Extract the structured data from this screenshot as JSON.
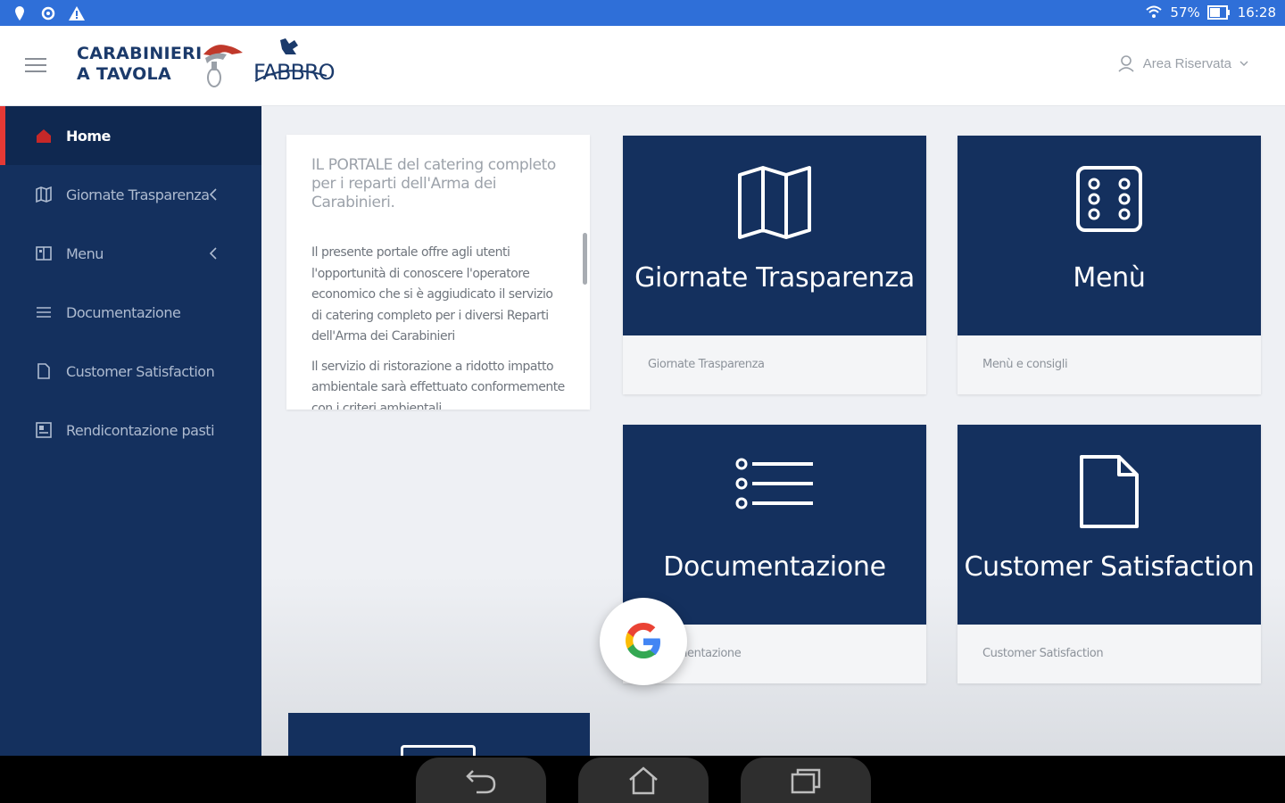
{
  "status_bar": {
    "battery": "57%",
    "time": "16:28",
    "left_icons": [
      "location-pin-icon",
      "sync-icon",
      "warning-icon"
    ],
    "right_icons": [
      "wifi-icon",
      "battery-icon"
    ]
  },
  "header": {
    "brand_line1": "CARABINIERI",
    "brand_line2": "A TAVOLA",
    "partner_logo_text": "FABBRO",
    "area_riservata_label": "Area Riservata"
  },
  "sidebar": {
    "items": [
      {
        "label": "Home",
        "icon": "home-icon",
        "active": true
      },
      {
        "label": "Giornate Trasparenza",
        "icon": "map-icon",
        "chevron": true
      },
      {
        "label": "Menu",
        "icon": "book-icon",
        "chevron": true
      },
      {
        "label": "Documentazione",
        "icon": "list-icon"
      },
      {
        "label": "Customer Satisfaction",
        "icon": "file-icon"
      },
      {
        "label": "Rendicontazione pasti",
        "icon": "report-icon"
      }
    ]
  },
  "intro": {
    "title": "IL PORTALE del catering completo per i reparti dell'Arma dei Carabinieri.",
    "p1": "Il presente portale offre agli utenti l'opportunità di conoscere l'operatore economico che si è aggiudicato il servizio di catering completo per i diversi Reparti dell'Arma dei Carabinieri",
    "p2": "Il servizio di ristorazione a ridotto impatto ambientale sarà effettuato conformemente con i criteri ambientali"
  },
  "tiles": [
    {
      "label": "Giornate Trasparenza",
      "caption": "Giornate Trasparenza",
      "icon": "map-icon"
    },
    {
      "label": "Menù",
      "caption": "Menù e consigli",
      "icon": "dice-icon"
    },
    {
      "label": "Documentazione",
      "caption": "Documentazione",
      "icon": "list-icon"
    },
    {
      "label": "Customer Satisfaction",
      "caption": "Customer Satisfaction",
      "icon": "file-icon"
    }
  ],
  "colors": {
    "status_bar": "#2f6fd8",
    "sidebar": "#14305e",
    "active_accent": "#e53935",
    "tile": "#14305e",
    "brand": "#1b3a6b"
  }
}
